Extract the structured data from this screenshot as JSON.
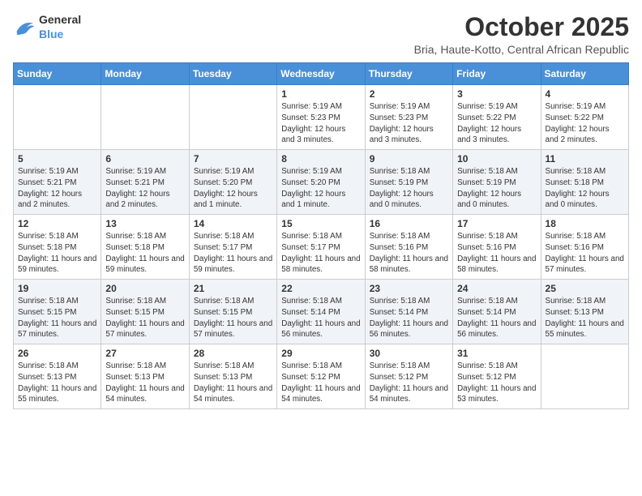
{
  "header": {
    "logo_general": "General",
    "logo_blue": "Blue",
    "month": "October 2025",
    "location": "Bria, Haute-Kotto, Central African Republic"
  },
  "weekdays": [
    "Sunday",
    "Monday",
    "Tuesday",
    "Wednesday",
    "Thursday",
    "Friday",
    "Saturday"
  ],
  "weeks": [
    [
      {
        "day": "",
        "sunrise": "",
        "sunset": "",
        "daylight": ""
      },
      {
        "day": "",
        "sunrise": "",
        "sunset": "",
        "daylight": ""
      },
      {
        "day": "",
        "sunrise": "",
        "sunset": "",
        "daylight": ""
      },
      {
        "day": "1",
        "sunrise": "Sunrise: 5:19 AM",
        "sunset": "Sunset: 5:23 PM",
        "daylight": "Daylight: 12 hours and 3 minutes."
      },
      {
        "day": "2",
        "sunrise": "Sunrise: 5:19 AM",
        "sunset": "Sunset: 5:23 PM",
        "daylight": "Daylight: 12 hours and 3 minutes."
      },
      {
        "day": "3",
        "sunrise": "Sunrise: 5:19 AM",
        "sunset": "Sunset: 5:22 PM",
        "daylight": "Daylight: 12 hours and 3 minutes."
      },
      {
        "day": "4",
        "sunrise": "Sunrise: 5:19 AM",
        "sunset": "Sunset: 5:22 PM",
        "daylight": "Daylight: 12 hours and 2 minutes."
      }
    ],
    [
      {
        "day": "5",
        "sunrise": "Sunrise: 5:19 AM",
        "sunset": "Sunset: 5:21 PM",
        "daylight": "Daylight: 12 hours and 2 minutes."
      },
      {
        "day": "6",
        "sunrise": "Sunrise: 5:19 AM",
        "sunset": "Sunset: 5:21 PM",
        "daylight": "Daylight: 12 hours and 2 minutes."
      },
      {
        "day": "7",
        "sunrise": "Sunrise: 5:19 AM",
        "sunset": "Sunset: 5:20 PM",
        "daylight": "Daylight: 12 hours and 1 minute."
      },
      {
        "day": "8",
        "sunrise": "Sunrise: 5:19 AM",
        "sunset": "Sunset: 5:20 PM",
        "daylight": "Daylight: 12 hours and 1 minute."
      },
      {
        "day": "9",
        "sunrise": "Sunrise: 5:18 AM",
        "sunset": "Sunset: 5:19 PM",
        "daylight": "Daylight: 12 hours and 0 minutes."
      },
      {
        "day": "10",
        "sunrise": "Sunrise: 5:18 AM",
        "sunset": "Sunset: 5:19 PM",
        "daylight": "Daylight: 12 hours and 0 minutes."
      },
      {
        "day": "11",
        "sunrise": "Sunrise: 5:18 AM",
        "sunset": "Sunset: 5:18 PM",
        "daylight": "Daylight: 12 hours and 0 minutes."
      }
    ],
    [
      {
        "day": "12",
        "sunrise": "Sunrise: 5:18 AM",
        "sunset": "Sunset: 5:18 PM",
        "daylight": "Daylight: 11 hours and 59 minutes."
      },
      {
        "day": "13",
        "sunrise": "Sunrise: 5:18 AM",
        "sunset": "Sunset: 5:18 PM",
        "daylight": "Daylight: 11 hours and 59 minutes."
      },
      {
        "day": "14",
        "sunrise": "Sunrise: 5:18 AM",
        "sunset": "Sunset: 5:17 PM",
        "daylight": "Daylight: 11 hours and 59 minutes."
      },
      {
        "day": "15",
        "sunrise": "Sunrise: 5:18 AM",
        "sunset": "Sunset: 5:17 PM",
        "daylight": "Daylight: 11 hours and 58 minutes."
      },
      {
        "day": "16",
        "sunrise": "Sunrise: 5:18 AM",
        "sunset": "Sunset: 5:16 PM",
        "daylight": "Daylight: 11 hours and 58 minutes."
      },
      {
        "day": "17",
        "sunrise": "Sunrise: 5:18 AM",
        "sunset": "Sunset: 5:16 PM",
        "daylight": "Daylight: 11 hours and 58 minutes."
      },
      {
        "day": "18",
        "sunrise": "Sunrise: 5:18 AM",
        "sunset": "Sunset: 5:16 PM",
        "daylight": "Daylight: 11 hours and 57 minutes."
      }
    ],
    [
      {
        "day": "19",
        "sunrise": "Sunrise: 5:18 AM",
        "sunset": "Sunset: 5:15 PM",
        "daylight": "Daylight: 11 hours and 57 minutes."
      },
      {
        "day": "20",
        "sunrise": "Sunrise: 5:18 AM",
        "sunset": "Sunset: 5:15 PM",
        "daylight": "Daylight: 11 hours and 57 minutes."
      },
      {
        "day": "21",
        "sunrise": "Sunrise: 5:18 AM",
        "sunset": "Sunset: 5:15 PM",
        "daylight": "Daylight: 11 hours and 57 minutes."
      },
      {
        "day": "22",
        "sunrise": "Sunrise: 5:18 AM",
        "sunset": "Sunset: 5:14 PM",
        "daylight": "Daylight: 11 hours and 56 minutes."
      },
      {
        "day": "23",
        "sunrise": "Sunrise: 5:18 AM",
        "sunset": "Sunset: 5:14 PM",
        "daylight": "Daylight: 11 hours and 56 minutes."
      },
      {
        "day": "24",
        "sunrise": "Sunrise: 5:18 AM",
        "sunset": "Sunset: 5:14 PM",
        "daylight": "Daylight: 11 hours and 56 minutes."
      },
      {
        "day": "25",
        "sunrise": "Sunrise: 5:18 AM",
        "sunset": "Sunset: 5:13 PM",
        "daylight": "Daylight: 11 hours and 55 minutes."
      }
    ],
    [
      {
        "day": "26",
        "sunrise": "Sunrise: 5:18 AM",
        "sunset": "Sunset: 5:13 PM",
        "daylight": "Daylight: 11 hours and 55 minutes."
      },
      {
        "day": "27",
        "sunrise": "Sunrise: 5:18 AM",
        "sunset": "Sunset: 5:13 PM",
        "daylight": "Daylight: 11 hours and 54 minutes."
      },
      {
        "day": "28",
        "sunrise": "Sunrise: 5:18 AM",
        "sunset": "Sunset: 5:13 PM",
        "daylight": "Daylight: 11 hours and 54 minutes."
      },
      {
        "day": "29",
        "sunrise": "Sunrise: 5:18 AM",
        "sunset": "Sunset: 5:12 PM",
        "daylight": "Daylight: 11 hours and 54 minutes."
      },
      {
        "day": "30",
        "sunrise": "Sunrise: 5:18 AM",
        "sunset": "Sunset: 5:12 PM",
        "daylight": "Daylight: 11 hours and 54 minutes."
      },
      {
        "day": "31",
        "sunrise": "Sunrise: 5:18 AM",
        "sunset": "Sunset: 5:12 PM",
        "daylight": "Daylight: 11 hours and 53 minutes."
      },
      {
        "day": "",
        "sunrise": "",
        "sunset": "",
        "daylight": ""
      }
    ]
  ]
}
